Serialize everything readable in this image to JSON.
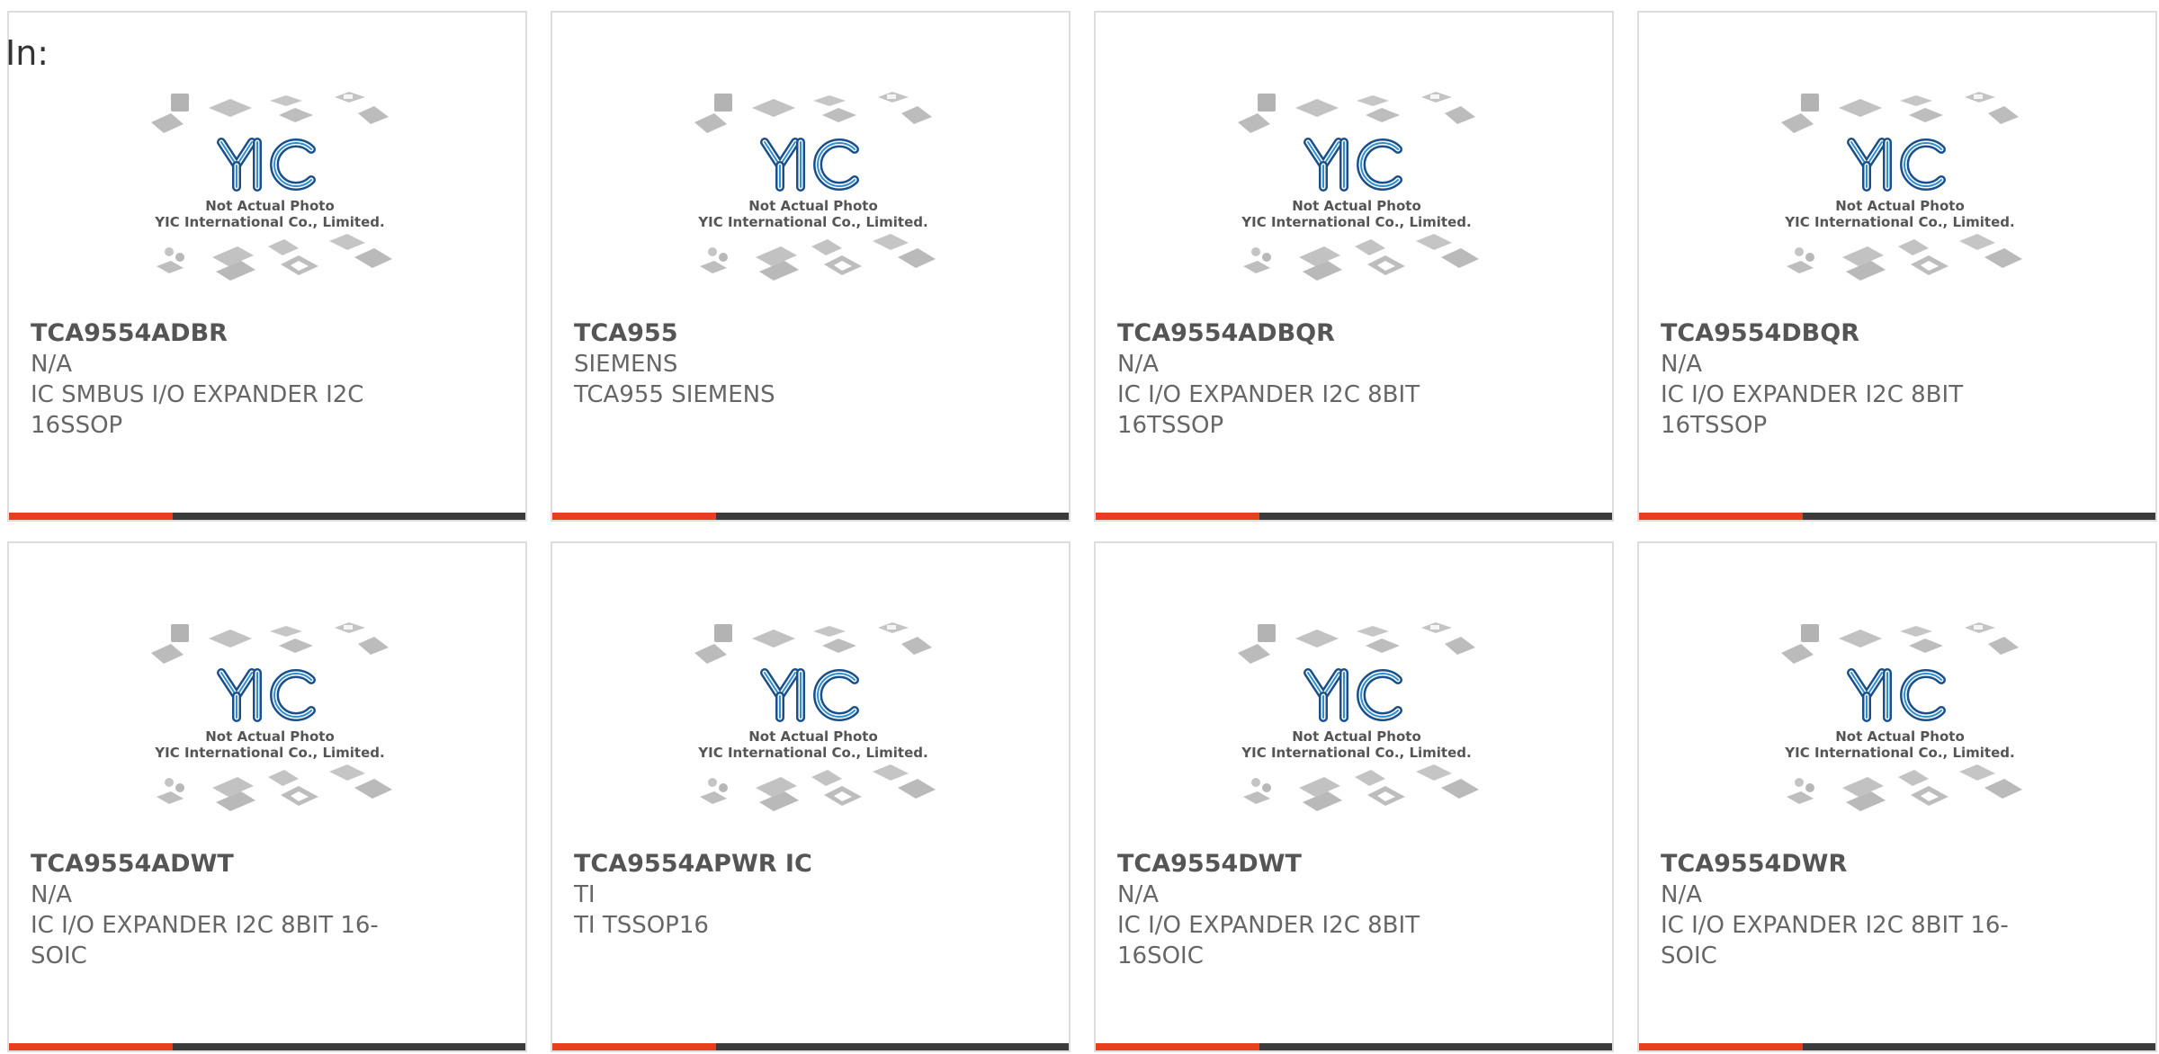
{
  "header": {
    "in_label": "In:"
  },
  "colors": {
    "accent_bar": "#e8401c",
    "dark_bar": "#3b3b3b",
    "logo_blue": "#2b8fd0",
    "logo_dark": "#1b4f8a",
    "chip_gray": "#b8b8b8",
    "text_gray": "#666666"
  },
  "photo": {
    "logo_text": "YIC",
    "line1": "Not Actual Photo",
    "line2": "YIC International Co., Limited."
  },
  "products": [
    {
      "part": "TCA9554ADBR",
      "brand": "N/A",
      "desc": "IC SMBUS I/O EXPANDER I2C 16SSOP"
    },
    {
      "part": "TCA955",
      "brand": "SIEMENS",
      "desc": "TCA955 SIEMENS"
    },
    {
      "part": "TCA9554ADBQR",
      "brand": "N/A",
      "desc": "IC I/O EXPANDER I2C 8BIT 16TSSOP"
    },
    {
      "part": "TCA9554DBQR",
      "brand": "N/A",
      "desc": "IC I/O EXPANDER I2C 8BIT 16TSSOP"
    },
    {
      "part": "TCA9554ADWT",
      "brand": "N/A",
      "desc": "IC I/O EXPANDER I2C 8BIT 16-SOIC"
    },
    {
      "part": "TCA9554APWR IC",
      "brand": "TI",
      "desc": "TI TSSOP16"
    },
    {
      "part": "TCA9554DWT",
      "brand": "N/A",
      "desc": "IC I/O EXPANDER I2C 8BIT 16SOIC"
    },
    {
      "part": "TCA9554DWR",
      "brand": "N/A",
      "desc": "IC I/O EXPANDER I2C 8BIT 16-SOIC"
    }
  ]
}
